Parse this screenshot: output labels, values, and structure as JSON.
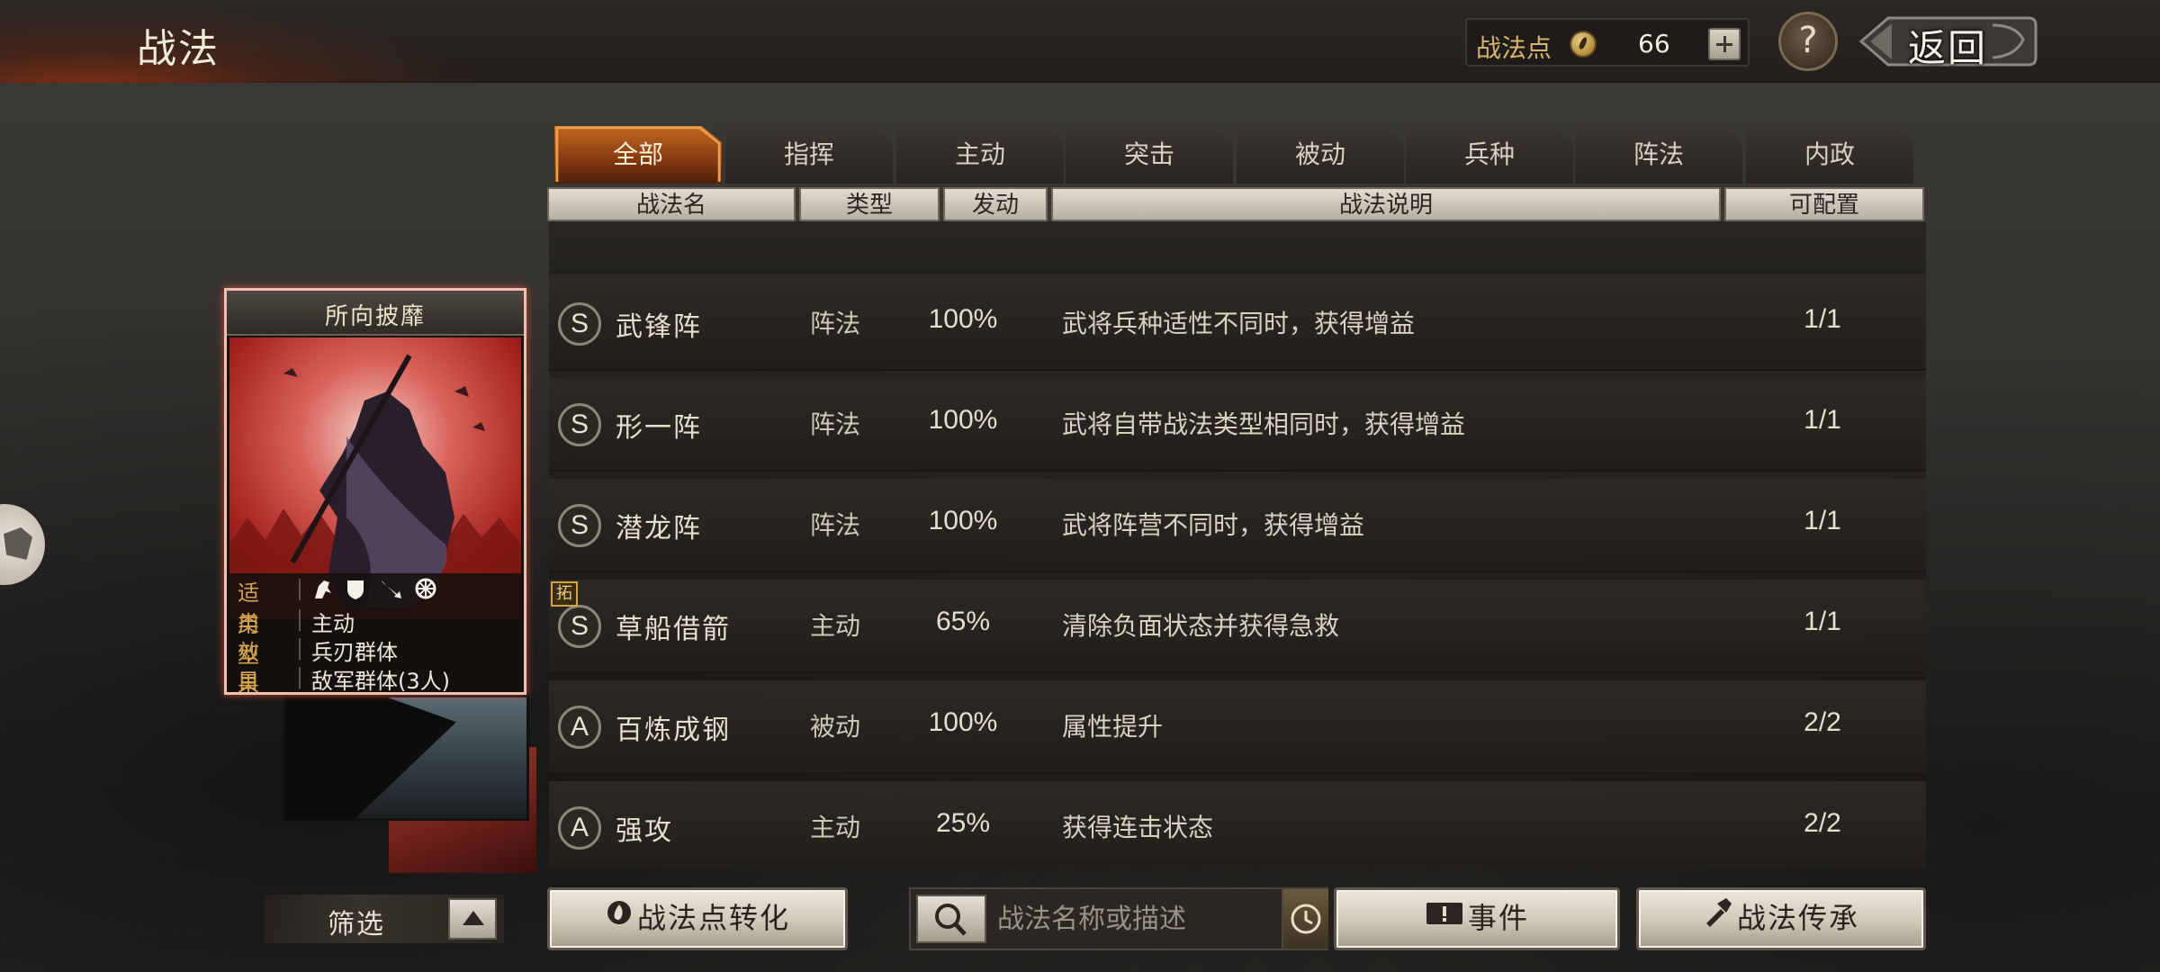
{
  "header": {
    "title": "战法",
    "points_label": "战法点",
    "points_value": "66",
    "help_label": "?",
    "back_label": "返回"
  },
  "tabs": [
    {
      "label": "全部",
      "active": true
    },
    {
      "label": "指挥",
      "active": false
    },
    {
      "label": "主动",
      "active": false
    },
    {
      "label": "突击",
      "active": false
    },
    {
      "label": "被动",
      "active": false
    },
    {
      "label": "兵种",
      "active": false
    },
    {
      "label": "阵法",
      "active": false
    },
    {
      "label": "内政",
      "active": false
    }
  ],
  "columns": {
    "name": "战法名",
    "type": "类型",
    "rate": "发动",
    "desc": "战法说明",
    "slots": "可配置"
  },
  "rows": [
    {
      "grade": "S",
      "name": "武锋阵",
      "type": "阵法",
      "rate": "100%",
      "desc": "武将兵种适性不同时，获得增益",
      "slots": "1/1"
    },
    {
      "grade": "S",
      "name": "形一阵",
      "type": "阵法",
      "rate": "100%",
      "desc": "武将自带战法类型相同时，获得增益",
      "slots": "1/1"
    },
    {
      "grade": "S",
      "name": "潜龙阵",
      "type": "阵法",
      "rate": "100%",
      "desc": "武将阵营不同时，获得增益",
      "slots": "1/1"
    },
    {
      "grade": "S",
      "name": "草船借箭",
      "type": "主动",
      "rate": "65%",
      "desc": "清除负面状态并获得急救",
      "slots": "1/1"
    },
    {
      "grade": "A",
      "name": "百炼成钢",
      "type": "被动",
      "rate": "100%",
      "desc": "属性提升",
      "slots": "2/2"
    },
    {
      "grade": "A",
      "name": "强攻",
      "type": "主动",
      "rate": "25%",
      "desc": "获得连击状态",
      "slots": "2/2"
    }
  ],
  "expand_tag": "拓",
  "card": {
    "title": "所向披靡",
    "applies_label": "适用",
    "type_label": "类型",
    "type_value": "主动",
    "effect_label": "效果",
    "effect_value": "兵刃群体",
    "target_label": "目标",
    "target_value": "敌军群体(3人)"
  },
  "bottom": {
    "filter_label": "筛选",
    "convert_label": "战法点转化",
    "search_placeholder": "战法名称或描述",
    "event_label": "事件",
    "inherit_label": "战法传承"
  },
  "colors": {
    "accent_orange": "#c46a21",
    "card_red": "#c93a33",
    "gold": "#d4a24f"
  }
}
